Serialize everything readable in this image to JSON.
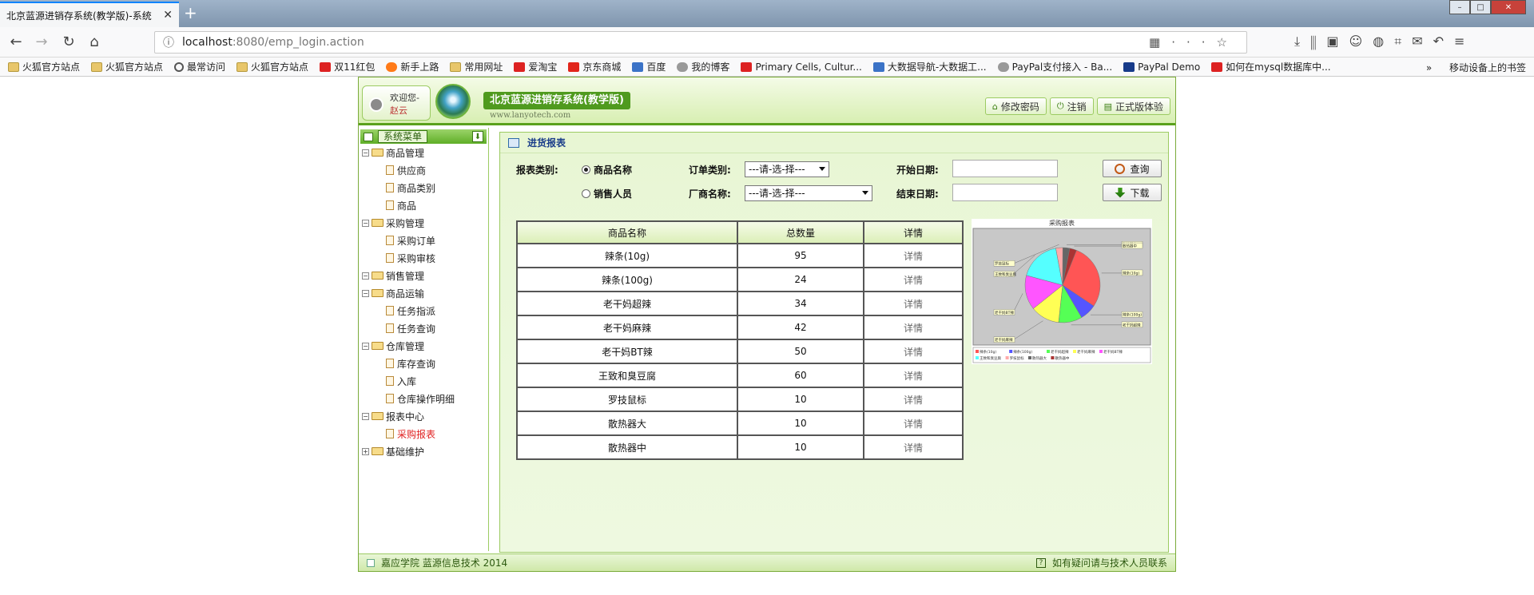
{
  "browser": {
    "tab_title": "北京蓝源进销存系统(教学版)-系统",
    "tab_close": "✕",
    "new_tab": "+",
    "url_host": "localhost",
    "url_rest": ":8080/emp_login.action",
    "bookmarks": [
      "火狐官方站点",
      "火狐官方站点",
      "最常访问",
      "火狐官方站点",
      "双11红包",
      "新手上路",
      "常用网址",
      "爱淘宝",
      "京东商城",
      "百度",
      "我的博客",
      "Primary Cells, Cultur...",
      "大数据导航-大数据工...",
      "PayPal支付接入 - Ba...",
      "PayPal Demo",
      "如何在mysql数据库中..."
    ],
    "mobile_bookmarks": "移动设备上的书签"
  },
  "app": {
    "welcome_label": "欢迎您-",
    "welcome_user": "赵云",
    "system_name": "北京蓝源进销存系统(教学版)",
    "system_url": "www.lanyotech.com",
    "top_buttons": [
      "修改密码",
      "注销",
      "正式版体验"
    ],
    "sidebar_title": "系统菜单",
    "menu": {
      "goods": "商品管理",
      "supplier": "供应商",
      "goods_type": "商品类别",
      "goods_item": "商品",
      "purchase": "采购管理",
      "purchase_order": "采购订单",
      "purchase_audit": "采购审核",
      "sales": "销售管理",
      "transport": "商品运输",
      "task_assign": "任务指派",
      "task_query": "任务查询",
      "warehouse": "仓库管理",
      "stock_query": "库存查询",
      "stock_in": "入库",
      "wh_detail": "仓库操作明细",
      "report": "报表中心",
      "purchase_report": "采购报表",
      "basic": "基础维护"
    },
    "footer_left": "嘉应学院 蓝源信息技术 2014",
    "footer_right": "如有疑问请与技术人员联系"
  },
  "report": {
    "title": "进货报表",
    "report_type_label": "报表类别:",
    "radio_goods": "商品名称",
    "radio_sales": "销售人员",
    "order_type_label": "订单类别:",
    "order_type_value": "---请-选-择---",
    "vendor_label": "厂商名称:",
    "vendor_value": "---请-选-择---",
    "start_label": "开始日期:",
    "end_label": "结束日期:",
    "query_btn": "查询",
    "download_btn": "下载",
    "col_name": "商品名称",
    "col_total": "总数量",
    "col_detail": "详情",
    "detail_text": "详情",
    "rows": [
      {
        "name": "辣条(10g)",
        "total": "95"
      },
      {
        "name": "辣条(100g)",
        "total": "24"
      },
      {
        "name": "老干妈超辣",
        "total": "34"
      },
      {
        "name": "老干妈麻辣",
        "total": "42"
      },
      {
        "name": "老干妈BT辣",
        "total": "50"
      },
      {
        "name": "王致和臭豆腐",
        "total": "60"
      },
      {
        "name": "罗技鼠标",
        "total": "10"
      },
      {
        "name": "散热器大",
        "total": "10"
      },
      {
        "name": "散热器中",
        "total": "10"
      }
    ]
  },
  "chart_data": {
    "type": "pie",
    "title": "采购报表",
    "categories": [
      "辣条(10g)",
      "辣条(100g)",
      "老干妈超辣",
      "老干妈麻辣",
      "老干妈BT辣",
      "王致和臭豆腐",
      "罗技鼠标",
      "散热器大",
      "散热器中"
    ],
    "values": [
      95,
      24,
      34,
      42,
      50,
      60,
      10,
      10,
      10
    ],
    "colors": [
      "#ff5555",
      "#5555ff",
      "#55ff55",
      "#ffff55",
      "#ff55ff",
      "#55ffff",
      "#ffaaaa",
      "#666666",
      "#aa3333"
    ],
    "legend": "bottom"
  }
}
